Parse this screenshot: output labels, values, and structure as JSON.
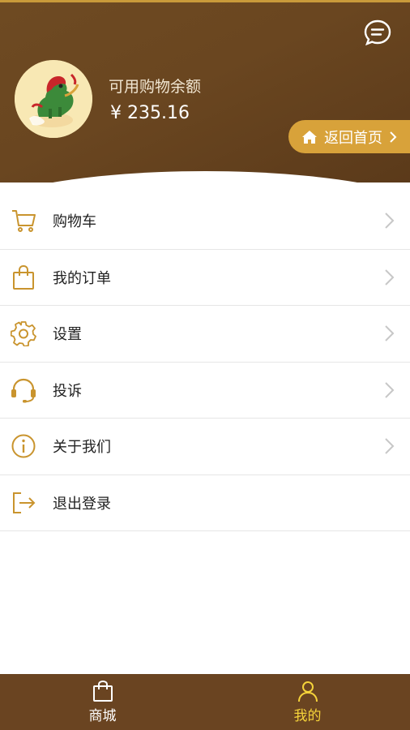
{
  "header": {
    "balance_label": "可用购物余额",
    "balance_value": "¥ 235.16",
    "home_button": "返回首页",
    "message_icon": "chat-bubble-icon",
    "avatar": "qilin-logo"
  },
  "menu": {
    "items": [
      {
        "label": "购物车",
        "icon": "cart-icon"
      },
      {
        "label": "我的订单",
        "icon": "bag-icon"
      },
      {
        "label": "设置",
        "icon": "gear-icon"
      },
      {
        "label": "投诉",
        "icon": "headset-icon"
      },
      {
        "label": "关于我们",
        "icon": "info-icon"
      },
      {
        "label": "退出登录",
        "icon": "logout-icon"
      }
    ]
  },
  "tabbar": {
    "tabs": [
      {
        "label": "商城",
        "icon": "shop-bag-icon",
        "active": false
      },
      {
        "label": "我的",
        "icon": "user-icon",
        "active": true
      }
    ]
  },
  "colors": {
    "brand_brown": "#6a4421",
    "accent_gold": "#d8a23a",
    "icon_gold": "#c9942e",
    "active_tab": "#f5d33a"
  }
}
